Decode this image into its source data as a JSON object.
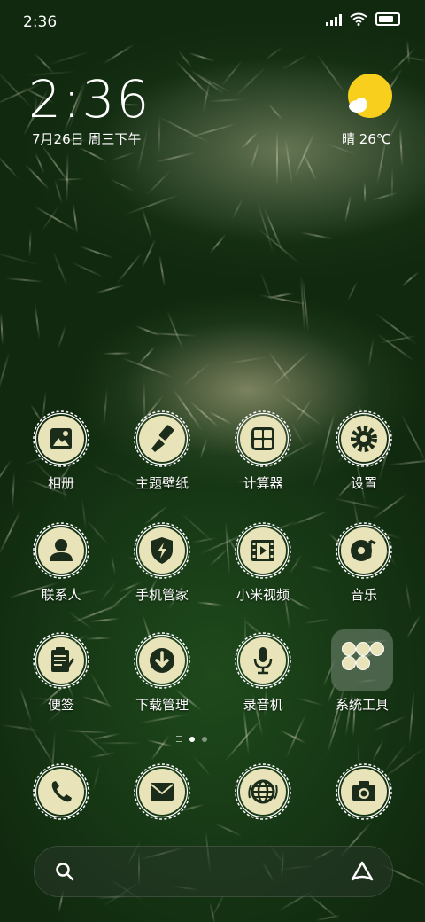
{
  "status_bar": {
    "time": "2:36"
  },
  "clock_widget": {
    "time": "2:36",
    "date": "7月26日 周三下午"
  },
  "weather_widget": {
    "text": "晴 26℃",
    "icon": "sun-cloud-icon"
  },
  "apps": [
    {
      "label": "相册",
      "icon": "gallery-icon"
    },
    {
      "label": "主题壁纸",
      "icon": "brush-icon"
    },
    {
      "label": "计算器",
      "icon": "calculator-icon"
    },
    {
      "label": "设置",
      "icon": "gear-icon"
    },
    {
      "label": "联系人",
      "icon": "person-icon"
    },
    {
      "label": "手机管家",
      "icon": "shield-bolt-icon"
    },
    {
      "label": "小米视频",
      "icon": "film-icon"
    },
    {
      "label": "音乐",
      "icon": "music-disc-icon"
    },
    {
      "label": "便签",
      "icon": "notepad-icon"
    },
    {
      "label": "下载管理",
      "icon": "download-icon"
    },
    {
      "label": "录音机",
      "icon": "microphone-icon"
    },
    {
      "label": "系统工具",
      "icon": "folder-icon"
    }
  ],
  "dock": [
    {
      "name": "phone",
      "icon": "phone-icon"
    },
    {
      "name": "messages",
      "icon": "envelope-icon"
    },
    {
      "name": "browser",
      "icon": "globe-icon"
    },
    {
      "name": "camera",
      "icon": "camera-icon"
    }
  ],
  "page_indicator": {
    "pages": 2,
    "current": 1
  },
  "colors": {
    "icon_fill": "#e8e3b9",
    "icon_glyph": "#1b2d1a",
    "weather_sun": "#f7cf1c"
  }
}
